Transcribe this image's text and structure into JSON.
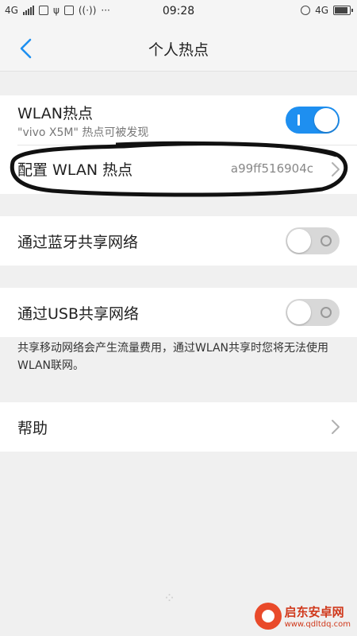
{
  "status_bar": {
    "network_left": "4G",
    "time": "09:28",
    "network_right": "4G",
    "more_icon": "···"
  },
  "header": {
    "title": "个人热点",
    "back_icon": "chevron-left-icon"
  },
  "wlan_hotspot": {
    "title": "WLAN热点",
    "subtitle": "\"vivo X5M\" 热点可被发现",
    "toggle_on": true
  },
  "configure_wlan": {
    "title": "配置 WLAN 热点",
    "value": "a99ff516904c"
  },
  "bluetooth_share": {
    "title": "通过蓝牙共享网络",
    "toggle_on": false
  },
  "usb_share": {
    "title": "通过USB共享网络",
    "toggle_on": false
  },
  "note": "共享移动网络会产生流量费用，通过WLAN共享时您将无法使用WLAN联网。",
  "help": {
    "title": "帮助"
  },
  "watermark": {
    "name": "启东安卓网",
    "url": "www.qdltdq.com"
  },
  "colors": {
    "accent": "#1e8ff0",
    "background": "#f0f0f0",
    "card": "#ffffff"
  }
}
